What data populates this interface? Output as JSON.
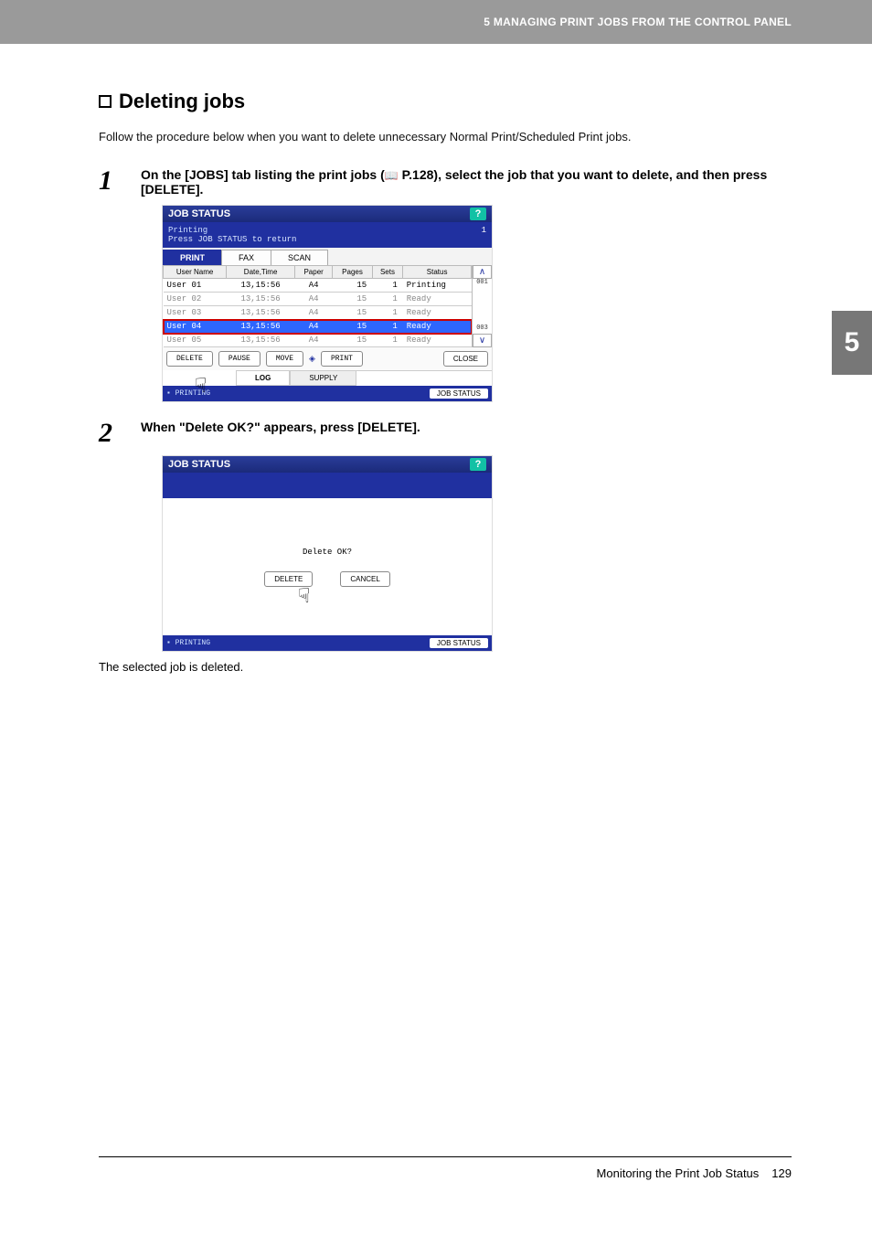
{
  "header": {
    "chapter": "5 MANAGING PRINT JOBS FROM THE CONTROL PANEL"
  },
  "side_tab": "5",
  "section": {
    "title": "Deleting jobs",
    "intro": "Follow the procedure below when you want to delete unnecessary Normal Print/Scheduled Print jobs."
  },
  "steps": {
    "s1": {
      "num": "1",
      "text_a": "On the [JOBS] tab listing the print jobs (",
      "text_ref": "P.128",
      "text_b": "), select the job that you want to delete, and then press [DELETE]."
    },
    "s2": {
      "num": "2",
      "text": "When \"Delete OK?\" appears, press [DELETE].",
      "after": "The selected job is deleted."
    }
  },
  "panel": {
    "title": "JOB STATUS",
    "help": "?",
    "sub_line1": "Printing",
    "sub_line2": "Press JOB STATUS to return",
    "sub_page": "1",
    "tabs": {
      "print": "PRINT",
      "fax": "FAX",
      "scan": "SCAN"
    },
    "columns": {
      "user": "User Name",
      "datetime": "Date,Time",
      "paper": "Paper",
      "pages": "Pages",
      "sets": "Sets",
      "status": "Status"
    },
    "rows": [
      {
        "user": "User 01",
        "datetime": "13,15:56",
        "paper": "A4",
        "pages": "15",
        "sets": "1",
        "status": "Printing"
      },
      {
        "user": "User 02",
        "datetime": "13,15:56",
        "paper": "A4",
        "pages": "15",
        "sets": "1",
        "status": "Ready"
      },
      {
        "user": "User 03",
        "datetime": "13,15:56",
        "paper": "A4",
        "pages": "15",
        "sets": "1",
        "status": "Ready"
      },
      {
        "user": "User 04",
        "datetime": "13,15:56",
        "paper": "A4",
        "pages": "15",
        "sets": "1",
        "status": "Ready"
      },
      {
        "user": "User 05",
        "datetime": "13,15:56",
        "paper": "A4",
        "pages": "15",
        "sets": "1",
        "status": "Ready"
      }
    ],
    "scroll": {
      "up": "001",
      "down": "003"
    },
    "buttons": {
      "delete": "DELETE",
      "pause": "PAUSE",
      "move": "MOVE",
      "print": "PRINT",
      "close": "CLOSE"
    },
    "subtabs": {
      "log": "LOG",
      "supply": "SUPPLY"
    },
    "footer": {
      "left": "PRINTING",
      "right": "JOB STATUS"
    }
  },
  "confirm": {
    "question": "Delete OK?",
    "delete": "DELETE",
    "cancel": "CANCEL"
  },
  "page_footer": {
    "label": "Monitoring the Print Job Status",
    "page": "129"
  }
}
